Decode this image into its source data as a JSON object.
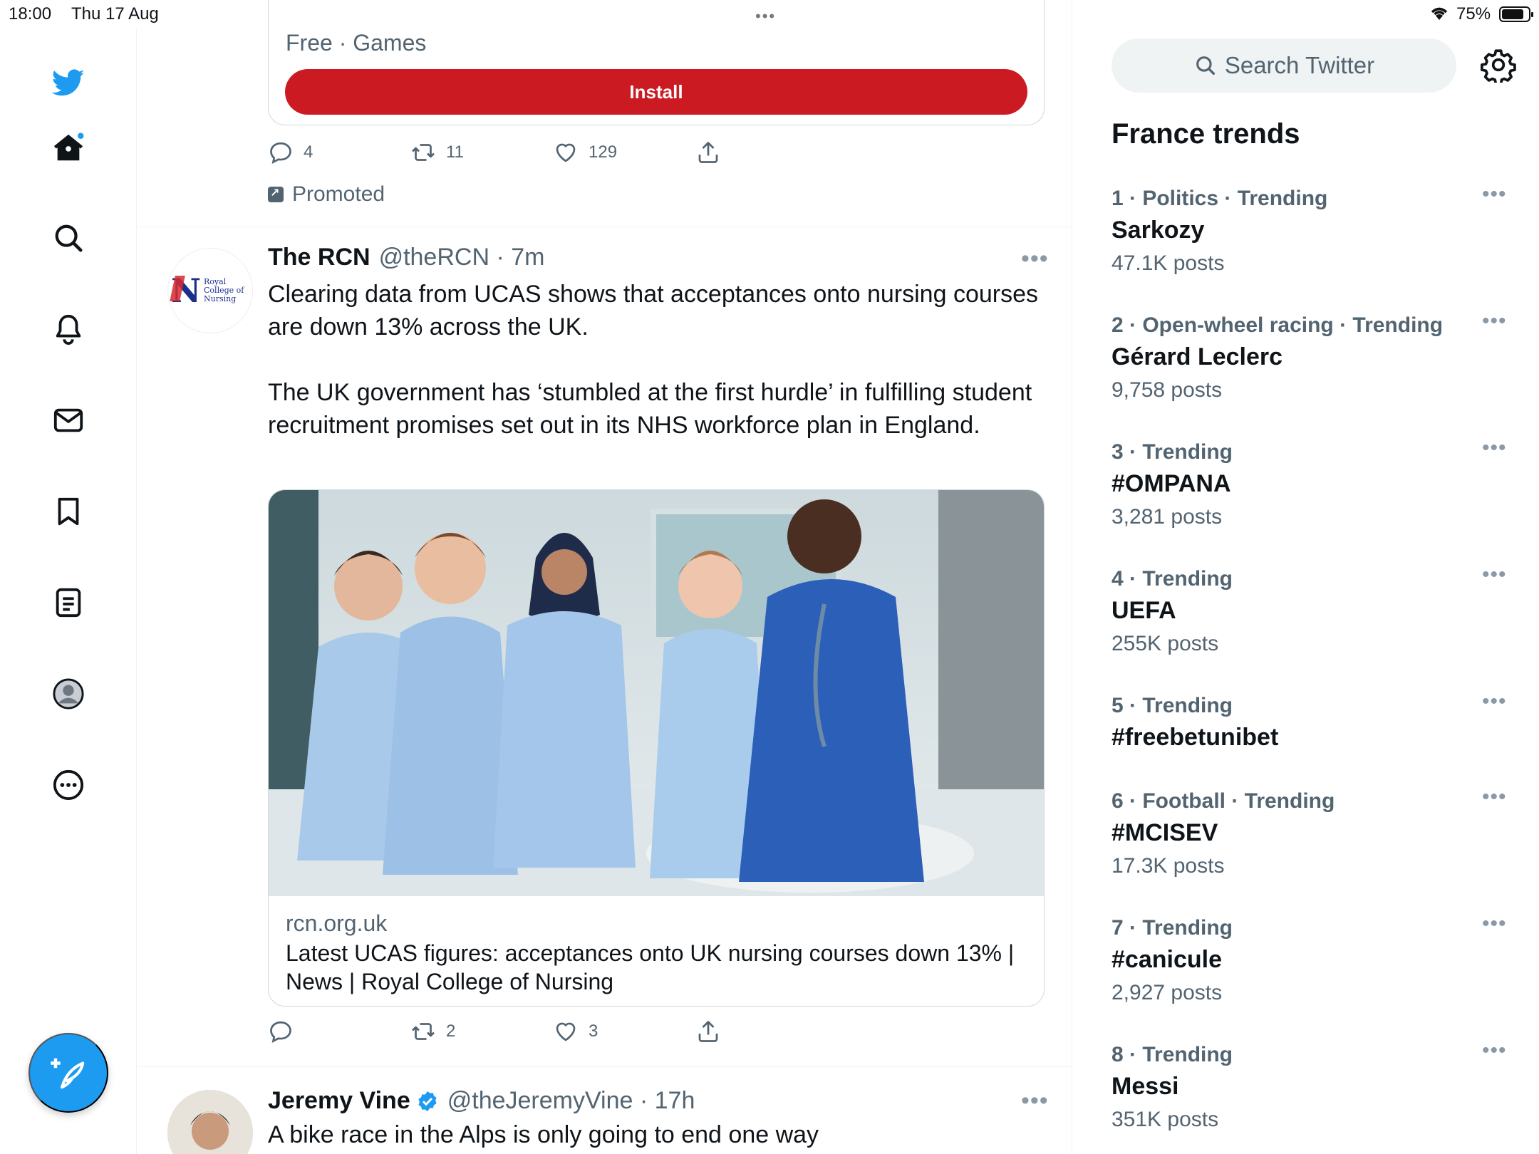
{
  "status_bar": {
    "time": "18:00",
    "date": "Thu 17 Aug",
    "dots": "•••",
    "battery": "75%"
  },
  "nav": {
    "items": [
      "twitter-logo",
      "home",
      "explore",
      "notifications",
      "messages",
      "bookmarks",
      "lists",
      "profile",
      "more"
    ],
    "compose_label": "Tweet"
  },
  "ad": {
    "meta": "Free · Games",
    "install_label": "Install",
    "replies": "4",
    "retweets": "11",
    "likes": "129",
    "promoted_label": "Promoted"
  },
  "tweet_rcn": {
    "name": "The RCN",
    "handle": "@theRCN · 7m",
    "more": "•••",
    "avatar_text": "Royal College of Nursing",
    "text": "Clearing data from UCAS shows that acceptances onto nursing courses are down 13% across the UK.\n\nThe UK government has ‘stumbled at the first hurdle’ in fulfilling student recruitment promises set out in its NHS workforce plan in England.",
    "link_domain": "rcn.org.uk",
    "link_title": "Latest UCAS figures: acceptances onto UK nursing courses down 13% | News | Royal College of Nursing",
    "replies": "",
    "retweets": "2",
    "likes": "3"
  },
  "tweet_jv": {
    "name": "Jeremy Vine",
    "handle": "@theJeremyVine · 17h",
    "more": "•••",
    "text": "A bike race in the Alps is only going to end one way"
  },
  "sidebar": {
    "search_placeholder": "Search Twitter",
    "trends_title": "France trends",
    "trends": [
      {
        "meta": "1 · Politics · Trending",
        "name": "Sarkozy",
        "count": "47.1K posts"
      },
      {
        "meta": "2 · Open-wheel racing · Trending",
        "name": "Gérard Leclerc",
        "count": "9,758 posts"
      },
      {
        "meta": "3 · Trending",
        "name": "#OMPANA",
        "count": "3,281 posts"
      },
      {
        "meta": "4 · Trending",
        "name": "UEFA",
        "count": "255K posts"
      },
      {
        "meta": "5 · Trending",
        "name": "#freebetunibet",
        "count": ""
      },
      {
        "meta": "6 · Football · Trending",
        "name": "#MCISEV",
        "count": "17.3K posts"
      },
      {
        "meta": "7 · Trending",
        "name": "#canicule",
        "count": "2,927 posts"
      },
      {
        "meta": "8 · Trending",
        "name": "Messi",
        "count": "351K posts"
      }
    ],
    "trend_more": "•••"
  },
  "colors": {
    "accent": "#1d9bf0",
    "install": "#cc1a22",
    "muted": "#536471"
  }
}
